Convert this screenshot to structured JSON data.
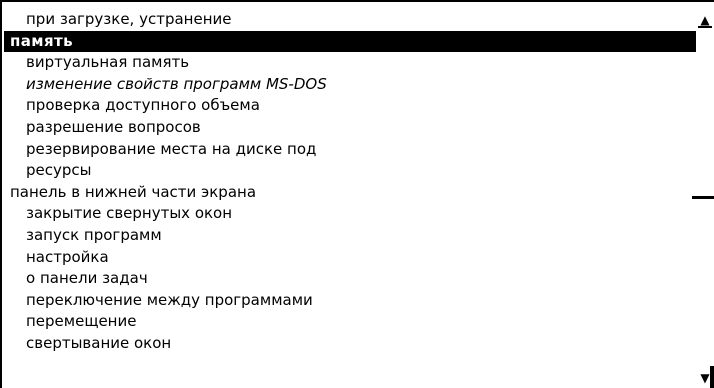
{
  "index_list": {
    "items": [
      {
        "label": "при загрузке, устранение",
        "level": "sub",
        "selected": false,
        "italic": false
      },
      {
        "label": "память",
        "level": "top",
        "selected": true,
        "italic": false
      },
      {
        "label": "виртуальная память",
        "level": "sub",
        "selected": false,
        "italic": false
      },
      {
        "label": "изменение свойств программ MS-DOS",
        "level": "sub",
        "selected": false,
        "italic": true
      },
      {
        "label": "проверка доступного объема",
        "level": "sub",
        "selected": false,
        "italic": false
      },
      {
        "label": "разрешение вопросов",
        "level": "sub",
        "selected": false,
        "italic": false
      },
      {
        "label": "резервирование места на диске под",
        "level": "sub",
        "selected": false,
        "italic": false
      },
      {
        "label": "ресурсы",
        "level": "sub",
        "selected": false,
        "italic": false
      },
      {
        "label": "панель в нижней части экрана",
        "level": "top",
        "selected": false,
        "italic": false
      },
      {
        "label": "закрытие свернутых окон",
        "level": "sub",
        "selected": false,
        "italic": false
      },
      {
        "label": "запуск программ",
        "level": "sub",
        "selected": false,
        "italic": false
      },
      {
        "label": "настройка",
        "level": "sub",
        "selected": false,
        "italic": false
      },
      {
        "label": "о панели задач",
        "level": "sub",
        "selected": false,
        "italic": false
      },
      {
        "label": "переключение между программами",
        "level": "sub",
        "selected": false,
        "italic": false
      },
      {
        "label": "перемещение",
        "level": "sub",
        "selected": false,
        "italic": false
      },
      {
        "label": "свертывание окон",
        "level": "sub",
        "selected": false,
        "italic": false
      }
    ]
  },
  "scrollbar": {
    "up_arrow_icon": "arrow-up-icon",
    "down_arrow_icon": "arrow-down-icon",
    "position_fraction": 0.5
  },
  "colors": {
    "selection_background": "#000000",
    "selection_text": "#ffffff",
    "text": "#000000",
    "background": "#ffffff"
  }
}
